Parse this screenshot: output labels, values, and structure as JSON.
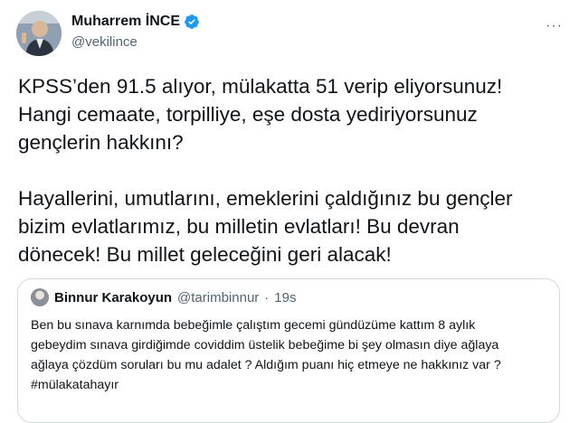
{
  "tweet": {
    "author": {
      "display_name": "Muharrem İNCE",
      "handle": "@vekilince",
      "verified": true
    },
    "more_label": "···",
    "paragraphs": [
      "KPSS’den 91.5 alıyor, mülakatta 51 verip eliyorsunuz!\nHangi cemaate, torpilliye, eşe dosta yediriyorsunuz\ngençlerin hakkını?",
      "Hayallerini, umutlarını, emeklerini çaldığınız bu gençler\nbizim evlatlarımız, bu milletin evlatları! Bu devran\ndönecek! Bu millet geleceğini geri alacak!"
    ],
    "quoted": {
      "display_name": "Binnur Karakoyun",
      "handle": "@tarimbinnur",
      "separator": "·",
      "time": "19s",
      "text": "Ben bu sınava karnımda bebeğimle çalıştım gecemi gündüzüme kattım 8 aylık\ngebeydim sınava girdiğimde coviddim üstelik bebeğime bi şey olmasın diye ağlaya\nağlaya çözdüm soruları bu mu adalet ? Aldığım puanı hiç etmeye ne hakkınız var ?\n#mülakatahayır"
    }
  },
  "colors": {
    "text": "#0f1419",
    "secondary": "#536471",
    "verified_blue": "#1d9bf0",
    "border": "#cfd9de"
  },
  "icons": {
    "verified": "verified-badge-icon",
    "more": "more-options-icon"
  }
}
